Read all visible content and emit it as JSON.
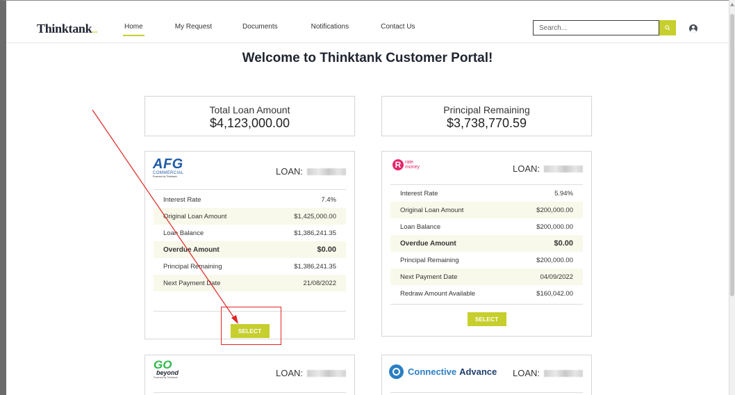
{
  "header": {
    "logo": "Thinktank",
    "logo_dots": "...",
    "nav": [
      "Home",
      "My Request",
      "Documents",
      "Notifications",
      "Contact Us"
    ],
    "search_placeholder": "Search...",
    "icons": {
      "search": "search-icon",
      "user": "user-avatar-icon"
    }
  },
  "welcome": "Welcome to Thinktank Customer Portal!",
  "summary": [
    {
      "label": "Total Loan Amount",
      "value": "$4,123,000.00"
    },
    {
      "label": "Principal Remaining",
      "value": "$3,738,770.59"
    }
  ],
  "loans": [
    {
      "lender": "AFG",
      "lender_sub": "COMMERCIAL",
      "lender_tag": "Powered by Thinktank",
      "loan_label": "LOAN:",
      "rows": [
        {
          "label": "Interest Rate",
          "value": "7.4%"
        },
        {
          "label": "Original Loan Amount",
          "value": "$1,425,000.00"
        },
        {
          "label": "Loan Balance",
          "value": "$1,386,241.35"
        },
        {
          "label": "Overdue Amount",
          "value": "$0.00"
        },
        {
          "label": "Principal Remaining",
          "value": "$1,386,241.35"
        },
        {
          "label": "Next Payment Date",
          "value": "21/08/2022"
        }
      ],
      "button": "SELECT"
    },
    {
      "lender": "rate money",
      "lender_letter": "R",
      "lender_top": "rate",
      "lender_bottom": "money",
      "loan_label": "LOAN:",
      "rows": [
        {
          "label": "Interest Rate",
          "value": "5.94%"
        },
        {
          "label": "Original Loan Amount",
          "value": "$200,000.00"
        },
        {
          "label": "Loan Balance",
          "value": "$200,000.00"
        },
        {
          "label": "Overdue Amount",
          "value": "$0.00"
        },
        {
          "label": "Principal Remaining",
          "value": "$200,000.00"
        },
        {
          "label": "Next Payment Date",
          "value": "04/09/2022"
        },
        {
          "label": "Redraw Amount Available",
          "value": "$160,042.00"
        }
      ],
      "button": "SELECT"
    },
    {
      "lender_go": "GO",
      "lender_beyond": "beyond",
      "lender_tag": "Powered by Thinktank",
      "loan_label": "LOAN:"
    },
    {
      "lender_a": "Connective",
      "lender_b": "Advance",
      "loan_label": "LOAN:"
    }
  ],
  "colors": {
    "accent": "#c6cf2d",
    "annotation": "#e02424",
    "afg_blue": "#1f5aa6",
    "rate_pink": "#e4266b",
    "connective_blue": "#2b7fc4"
  }
}
